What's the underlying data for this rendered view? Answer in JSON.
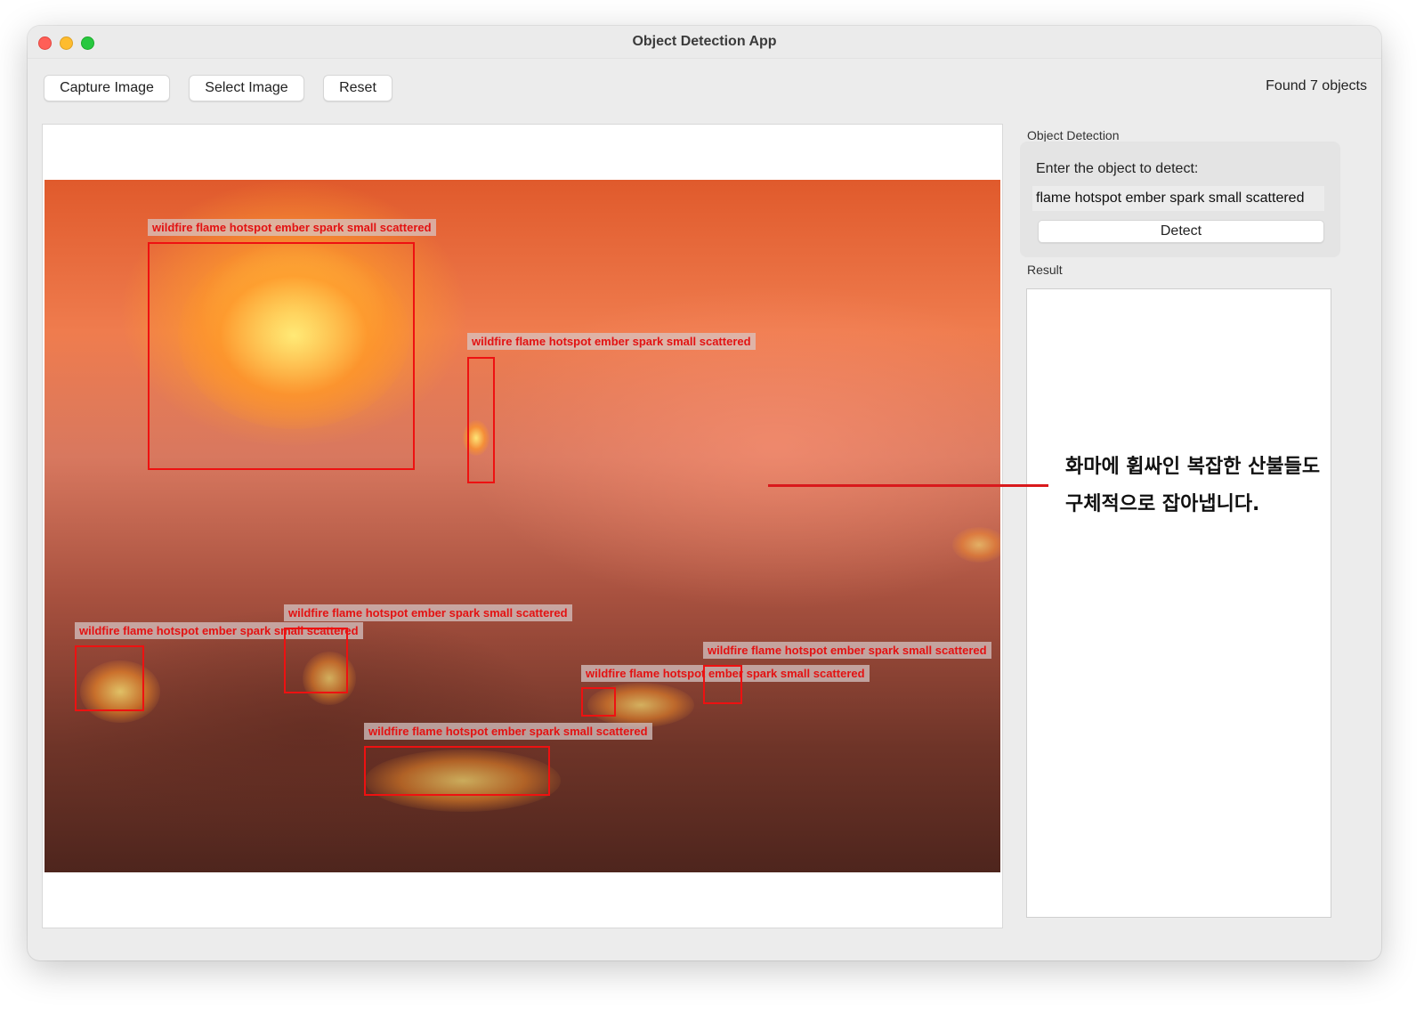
{
  "window": {
    "title": "Object Detection App"
  },
  "toolbar": {
    "capture_label": "Capture Image",
    "select_label": "Select Image",
    "reset_label": "Reset",
    "status_text": "Found 7 objects"
  },
  "detections": {
    "label": "wildfire flame hotspot ember spark small scattered",
    "label_color": "#e31212",
    "box_color": "#ee1111",
    "items": [
      {
        "label": "wildfire flame hotspot ember spark small scattered"
      },
      {
        "label": "wildfire flame hotspot ember spark small scattered"
      },
      {
        "label": "wildfire flame hotspot ember spark small scattered"
      },
      {
        "label": "wildfire flame hotspot ember spark small scattered"
      },
      {
        "label": "wildfire flame hotspot ember spark small scattered"
      },
      {
        "label": "wildfire flame hotspot ember spark small scattered"
      },
      {
        "label": "wildfire flame hotspot ember spark small scattered"
      },
      {
        "label": "wildfire flame hotspot ember spark small scattered"
      }
    ]
  },
  "sidebar": {
    "group_title": "Object Detection",
    "prompt_label": "Enter the object to detect:",
    "prompt_value": "flame hotspot ember spark small scattered",
    "detect_label": "Detect",
    "result_title": "Result"
  },
  "annotation": {
    "line1": "화마에 휩싸인 복잡한 산불들도",
    "line2": "구체적으로 잡아냅니다.",
    "line_color": "#d9191c"
  }
}
